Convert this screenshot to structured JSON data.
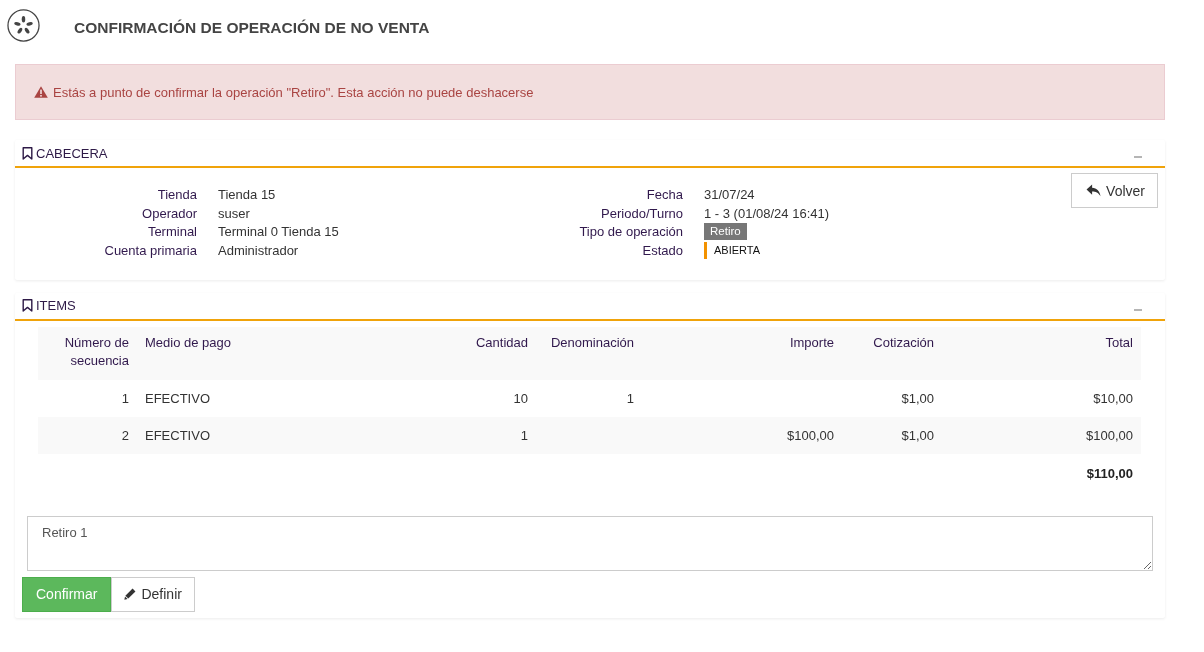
{
  "header": {
    "title": "CONFIRMACIÓN DE OPERACIÓN DE NO VENTA"
  },
  "alert": {
    "text": "Estás a punto de confirmar la operación \"Retiro\". Esta acción no puede deshacerse"
  },
  "cabecera": {
    "title": "CABECERA",
    "left_fields": [
      {
        "label": "Tienda",
        "value": "Tienda 15",
        "kind": "text"
      },
      {
        "label": "Operador",
        "value": "suser",
        "kind": "text"
      },
      {
        "label": "Terminal",
        "value": "Terminal 0 Tienda 15",
        "kind": "text"
      },
      {
        "label": "Cuenta primaria",
        "value": "Administrador",
        "kind": "text"
      }
    ],
    "right_fields": [
      {
        "label": "Fecha",
        "value": "31/07/24",
        "kind": "text"
      },
      {
        "label": "Periodo/Turno",
        "value": "1 - 3 (01/08/24 16:41)",
        "kind": "text"
      },
      {
        "label": "Tipo de operación",
        "value": "Retiro",
        "kind": "badge"
      },
      {
        "label": "Estado",
        "value": "ABIERTA",
        "kind": "status"
      }
    ],
    "back_button": {
      "label": "Volver"
    }
  },
  "items": {
    "title": "ITEMS",
    "table": {
      "columns": [
        "Número de secuencia",
        "Medio de pago",
        "Cantidad",
        "Denominación",
        "Importe",
        "Cotización",
        "Total"
      ],
      "rows": [
        [
          "1",
          "EFECTIVO",
          "10",
          "1",
          null,
          "$1,00",
          "$10,00"
        ],
        [
          "2",
          "EFECTIVO",
          "1",
          null,
          "$100,00",
          "$1,00",
          "$100,00"
        ]
      ],
      "total": "$110,00"
    },
    "note": {
      "value": "Retiro 1"
    },
    "actions": [
      {
        "label": "Confirmar",
        "kind": "primary"
      },
      {
        "label": "Definir",
        "kind": "edit"
      }
    ]
  }
}
